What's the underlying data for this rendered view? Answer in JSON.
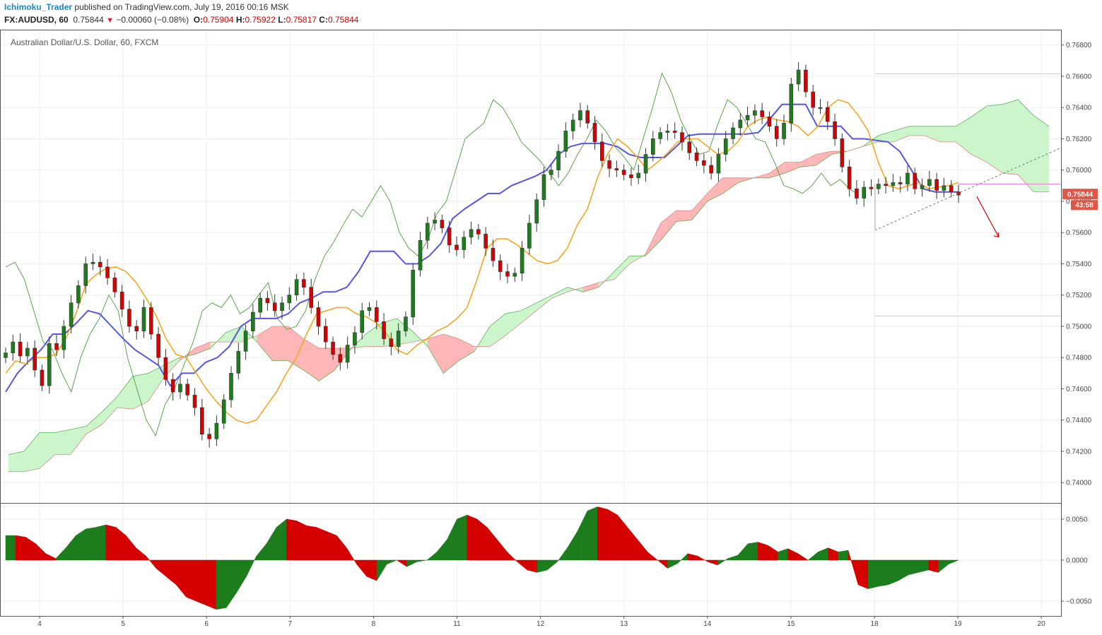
{
  "header": {
    "publisher": "Ichimoku_Trader",
    "published_text": "published on TradingView.com, July 19, 2016 00:16 MSK",
    "symbol": "FX:AUDUSD, 60",
    "last": "0.75844",
    "change_arrow": "▼",
    "change": "−0.00060 (−0.08%)",
    "o_label": "O:",
    "o_value": "0.75904",
    "h_label": "H:",
    "h_value": "0.75922",
    "l_label": "L:",
    "l_value": "0.75817",
    "c_label": "C:",
    "c_value": "0.75844"
  },
  "colors": {
    "bull": "#1b7d1b",
    "bear": "#d50000",
    "tenkan": "#f5a623",
    "kijun": "#5555e6",
    "chikou": "#4a9a3a",
    "cloud_bull": "#ccf5cc",
    "cloud_bear": "#ffb6b6",
    "grid": "#eeeeee",
    "axis": "#555555",
    "price_tag": "#e05545"
  },
  "chart_data": [
    {
      "type": "line",
      "title": "Australian Dollar/U.S. Dollar, 60, FXCM",
      "xlabel": "",
      "ylabel": "",
      "x_ticks": [
        "4",
        "5",
        "6",
        "7",
        "8",
        "11",
        "12",
        "13",
        "14",
        "15",
        "18",
        "19",
        "20"
      ],
      "ylim": [
        0.7387,
        0.7688
      ],
      "y_ticks": [
        "0.76800",
        "0.76600",
        "0.76400",
        "0.76200",
        "0.76000",
        "0.75800",
        "0.75600",
        "0.75400",
        "0.75200",
        "0.75000",
        "0.74800",
        "0.74600",
        "0.74400",
        "0.74200",
        "0.74000"
      ],
      "last_price_label": "0.75844",
      "countdown_label": "43:58",
      "grid": true,
      "close": [
        0.7483,
        0.749,
        0.7481,
        0.7486,
        0.7472,
        0.7462,
        0.7489,
        0.7485,
        0.75,
        0.7515,
        0.7526,
        0.754,
        0.7541,
        0.7538,
        0.7531,
        0.7522,
        0.7511,
        0.75,
        0.7497,
        0.7512,
        0.7495,
        0.748,
        0.7466,
        0.7458,
        0.7463,
        0.7456,
        0.7448,
        0.7431,
        0.7428,
        0.7438,
        0.7453,
        0.747,
        0.7484,
        0.7497,
        0.7509,
        0.7518,
        0.7515,
        0.751,
        0.7515,
        0.752,
        0.753,
        0.7525,
        0.7512,
        0.75,
        0.749,
        0.7482,
        0.7477,
        0.7488,
        0.7496,
        0.751,
        0.7512,
        0.7503,
        0.7492,
        0.7487,
        0.7497,
        0.7506,
        0.7536,
        0.7555,
        0.7566,
        0.7568,
        0.7563,
        0.7552,
        0.7549,
        0.7557,
        0.7562,
        0.7559,
        0.755,
        0.7542,
        0.7535,
        0.7532,
        0.7534,
        0.755,
        0.7566,
        0.7581,
        0.7597,
        0.76,
        0.7612,
        0.7625,
        0.7632,
        0.7638,
        0.763,
        0.7618,
        0.7606,
        0.7601,
        0.76,
        0.7597,
        0.7595,
        0.7598,
        0.761,
        0.762,
        0.7624,
        0.7625,
        0.7624,
        0.7618,
        0.7611,
        0.7606,
        0.7603,
        0.7598,
        0.761,
        0.762,
        0.7627,
        0.7632,
        0.7635,
        0.7638,
        0.7634,
        0.7628,
        0.762,
        0.763,
        0.7655,
        0.7664,
        0.765,
        0.764,
        0.764,
        0.7631,
        0.762,
        0.7602,
        0.7588,
        0.7582,
        0.7589,
        0.7588,
        0.7591,
        0.759,
        0.7592,
        0.7591,
        0.7598,
        0.7588,
        0.759,
        0.7594,
        0.7587,
        0.759,
        0.7586,
        0.7584
      ],
      "tenkan": [
        0.747,
        0.7478,
        0.7476,
        0.748,
        0.748,
        0.7482,
        0.7492,
        0.7508,
        0.7527,
        0.7533,
        0.7537,
        0.7538,
        0.7535,
        0.7528,
        0.7518,
        0.7507,
        0.7492,
        0.7482,
        0.748,
        0.747,
        0.746,
        0.7452,
        0.7445,
        0.744,
        0.7438,
        0.744,
        0.7449,
        0.7458,
        0.747,
        0.748,
        0.7495,
        0.7508,
        0.751,
        0.7512,
        0.7512,
        0.7508,
        0.7506,
        0.7502,
        0.7495,
        0.7485,
        0.7482,
        0.7488,
        0.7492,
        0.7497,
        0.75,
        0.7505,
        0.7512,
        0.753,
        0.755,
        0.7556,
        0.7556,
        0.7552,
        0.7547,
        0.7542,
        0.754,
        0.7542,
        0.755,
        0.7565,
        0.7575,
        0.7595,
        0.761,
        0.762,
        0.7615,
        0.7608,
        0.76,
        0.7605,
        0.7611,
        0.7618,
        0.762,
        0.762,
        0.7615,
        0.761,
        0.7612,
        0.7618,
        0.7628,
        0.7632,
        0.7634,
        0.7632,
        0.7631,
        0.7628,
        0.7622,
        0.7628,
        0.764,
        0.7645,
        0.7643,
        0.7635,
        0.7625,
        0.7605,
        0.759,
        0.7588,
        0.759,
        0.7592,
        0.7588,
        0.7589,
        0.759,
        0.7592
      ],
      "kijun": [
        0.7458,
        0.747,
        0.7478,
        0.7485,
        0.7495,
        0.7495,
        0.7502,
        0.751,
        0.7508,
        0.75,
        0.7492,
        0.7485,
        0.748,
        0.7475,
        0.7462,
        0.747,
        0.747,
        0.7477,
        0.748,
        0.7487,
        0.75,
        0.7505,
        0.7505,
        0.7505,
        0.7508,
        0.7515,
        0.7518,
        0.7522,
        0.7522,
        0.7525,
        0.7535,
        0.7548,
        0.7548,
        0.7548,
        0.754,
        0.754,
        0.7545,
        0.7553,
        0.7569,
        0.7575,
        0.758,
        0.7585,
        0.7585,
        0.759,
        0.7593,
        0.7596,
        0.76,
        0.761,
        0.7615,
        0.7617,
        0.7617,
        0.7617,
        0.7615,
        0.761,
        0.7608,
        0.7608,
        0.7608,
        0.7615,
        0.7622,
        0.7623,
        0.7623,
        0.7623,
        0.7623,
        0.7623,
        0.7624,
        0.7633,
        0.7642,
        0.7642,
        0.7642,
        0.7628,
        0.7628,
        0.7628,
        0.762,
        0.762,
        0.7619,
        0.7618,
        0.7612,
        0.76,
        0.7588,
        0.7586,
        0.7586,
        0.7586
      ],
      "chikou": [
        0.7538,
        0.7541,
        0.753,
        0.751,
        0.749,
        0.7485,
        0.747,
        0.7458,
        0.748,
        0.7495,
        0.7505,
        0.752,
        0.751,
        0.748,
        0.746,
        0.744,
        0.743,
        0.745,
        0.746,
        0.7475,
        0.749,
        0.751,
        0.7515,
        0.7512,
        0.752,
        0.7508,
        0.7512,
        0.752,
        0.7528,
        0.7505,
        0.7498,
        0.75,
        0.751,
        0.753,
        0.7545,
        0.7554,
        0.7565,
        0.7575,
        0.757,
        0.758,
        0.759,
        0.758,
        0.756,
        0.755,
        0.7545,
        0.7555,
        0.7572,
        0.758,
        0.76,
        0.762,
        0.7625,
        0.763,
        0.7645,
        0.764,
        0.763,
        0.7618,
        0.7612,
        0.7606,
        0.7598,
        0.759,
        0.7598,
        0.761,
        0.762,
        0.7632,
        0.7625,
        0.7615,
        0.7608,
        0.76,
        0.762,
        0.764,
        0.7662,
        0.765,
        0.7632,
        0.762,
        0.761,
        0.7612,
        0.763,
        0.7645,
        0.764,
        0.763,
        0.762,
        0.7618,
        0.7605,
        0.759,
        0.7588,
        0.7585,
        0.759,
        0.7598,
        0.759,
        0.7594,
        0.7588,
        0.7584
      ],
      "senkou_a": [
        0.7418,
        0.742,
        0.7432,
        0.7432,
        0.7434,
        0.7436,
        0.7445,
        0.7455,
        0.7468,
        0.747,
        0.7475,
        0.748,
        0.7482,
        0.7486,
        0.7496,
        0.75,
        0.749,
        0.7478,
        0.7478,
        0.7472,
        0.7465,
        0.7472,
        0.7485,
        0.7495,
        0.7502,
        0.7505,
        0.7497,
        0.7487,
        0.747,
        0.7478,
        0.7484,
        0.75,
        0.7508,
        0.751,
        0.7515,
        0.752,
        0.7525,
        0.7522,
        0.7525,
        0.7535,
        0.7545,
        0.7545,
        0.7555,
        0.7567,
        0.7568,
        0.758,
        0.7585,
        0.7592,
        0.7595,
        0.7595,
        0.7598,
        0.7602,
        0.7603,
        0.761,
        0.7612,
        0.7615,
        0.7622,
        0.7625,
        0.7628,
        0.7628,
        0.7628,
        0.7628,
        0.7634,
        0.7641,
        0.7642,
        0.7645,
        0.7635,
        0.7628
      ],
      "senkou_b": [
        0.7407,
        0.7407,
        0.7409,
        0.7418,
        0.7418,
        0.7431,
        0.7437,
        0.7448,
        0.7447,
        0.7452,
        0.7467,
        0.7478,
        0.7486,
        0.749,
        0.749,
        0.749,
        0.7494,
        0.75,
        0.75,
        0.7492,
        0.7486,
        0.7486,
        0.7486,
        0.7487,
        0.7487,
        0.7488,
        0.749,
        0.7492,
        0.7495,
        0.7492,
        0.7487,
        0.7487,
        0.7494,
        0.7502,
        0.751,
        0.7518,
        0.7522,
        0.7525,
        0.7528,
        0.753,
        0.754,
        0.7546,
        0.7566,
        0.7574,
        0.7574,
        0.7585,
        0.7595,
        0.7595,
        0.7595,
        0.7598,
        0.7605,
        0.7605,
        0.761,
        0.7612,
        0.7612,
        0.7615,
        0.7618,
        0.7618,
        0.7622,
        0.7622,
        0.7618,
        0.7618,
        0.761,
        0.7605,
        0.7598,
        0.7597,
        0.7586,
        0.7586
      ]
    },
    {
      "type": "area",
      "title": "",
      "ylim": [
        -0.0068,
        0.0068
      ],
      "y_ticks": [
        "0.0050",
        "0.0000",
        "−0.0050"
      ],
      "values": [
        0.003,
        0.003,
        0.0028,
        0.002,
        0.0008,
        0.0002,
        0.0015,
        0.003,
        0.0038,
        0.004,
        0.0043,
        0.004,
        0.003,
        0.0015,
        0.0005,
        -0.001,
        -0.002,
        -0.003,
        -0.0045,
        -0.005,
        -0.0055,
        -0.006,
        -0.0058,
        -0.004,
        -0.002,
        0.0005,
        0.002,
        0.004,
        0.005,
        0.0048,
        0.0042,
        0.004,
        0.0035,
        0.003,
        0.0015,
        -0.0005,
        -0.002,
        -0.0025,
        -0.0005,
        0.0,
        -0.0008,
        -0.0002,
        0.0,
        0.001,
        0.0025,
        0.005,
        0.0055,
        0.005,
        0.004,
        0.0025,
        0.001,
        -0.0002,
        -0.0012,
        -0.0015,
        -0.0012,
        -0.0002,
        0.0015,
        0.0035,
        0.006,
        0.0065,
        0.0062,
        0.0055,
        0.004,
        0.0025,
        0.001,
        0.0,
        -0.001,
        -0.0004,
        0.0008,
        0.0005,
        -0.0002,
        -0.0006,
        0.0002,
        0.0006,
        0.002,
        0.0022,
        0.0018,
        0.001,
        0.0014,
        0.0008,
        0.0,
        0.001,
        0.0015,
        0.001,
        0.0012,
        -0.003,
        -0.0035,
        -0.0032,
        -0.003,
        -0.0025,
        -0.0018,
        -0.0015,
        -0.0012,
        -0.0015,
        -0.0005,
        0.0
      ]
    }
  ]
}
